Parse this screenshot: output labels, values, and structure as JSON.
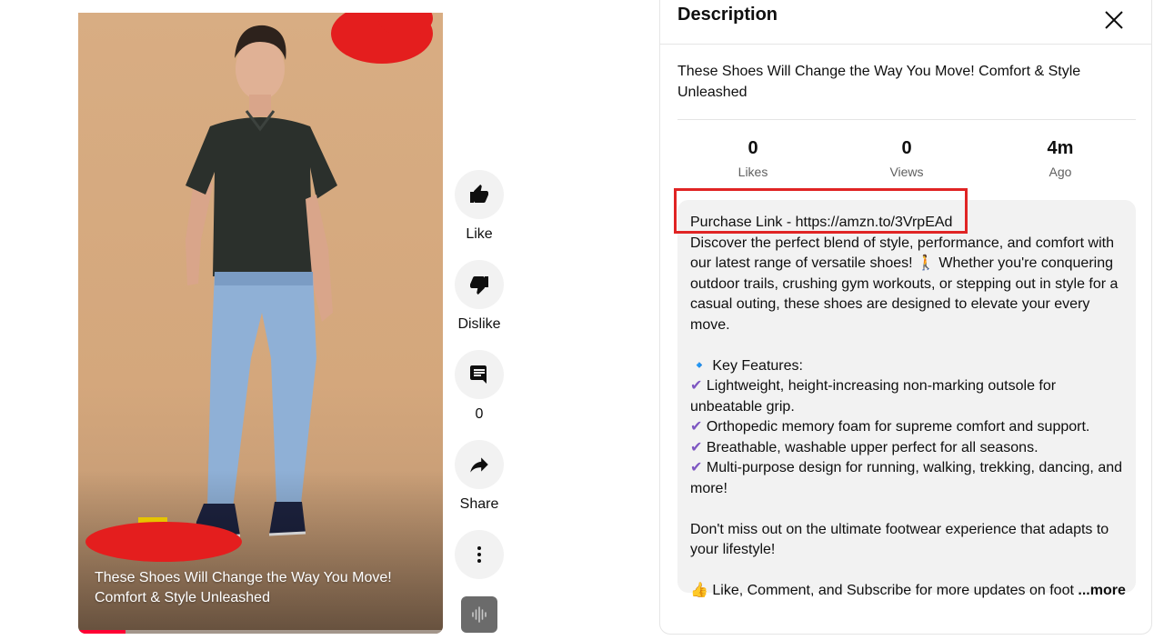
{
  "video": {
    "title": "These Shoes Will Change the Way You Move! Comfort & Style Unleashed",
    "progress": 0.13,
    "progress_color": "#ff0033"
  },
  "actions": {
    "like_label": "Like",
    "dislike_label": "Dislike",
    "comments_count": "0",
    "share_label": "Share"
  },
  "description": {
    "header": "Description",
    "title": "These Shoes Will Change the Way You Move! Comfort & Style Unleashed",
    "stats": [
      {
        "value": "0",
        "caption": "Likes"
      },
      {
        "value": "0",
        "caption": "Views"
      },
      {
        "value": "4m",
        "caption": "Ago"
      }
    ],
    "purchase_link": "Purchase Link - https://amzn.to/3VrpEAd",
    "intro": "Discover the perfect blend of style, performance, and comfort with our latest range of versatile shoes! 🚶 Whether you're conquering outdoor trails, crushing gym workouts, or stepping out in style for a casual outing, these shoes are designed to elevate your every move.",
    "features_heading": "🔹 Key Features:",
    "features": [
      "Lightweight, height-increasing non-marking outsole for unbeatable grip.",
      "Orthopedic memory foam for supreme comfort and support.",
      "Breathable, washable upper perfect for all seasons.",
      "Multi-purpose design for running, walking, trekking, dancing, and more!"
    ],
    "closing": "Don't miss out on the ultimate footwear experience that adapts to your lifestyle!",
    "cta": "👍 Like, Comment, and Subscribe for more updates on foot",
    "more_label": "...more"
  },
  "colors": {
    "annotation_red": "#e02424",
    "check_purple": "#7e57c2"
  }
}
